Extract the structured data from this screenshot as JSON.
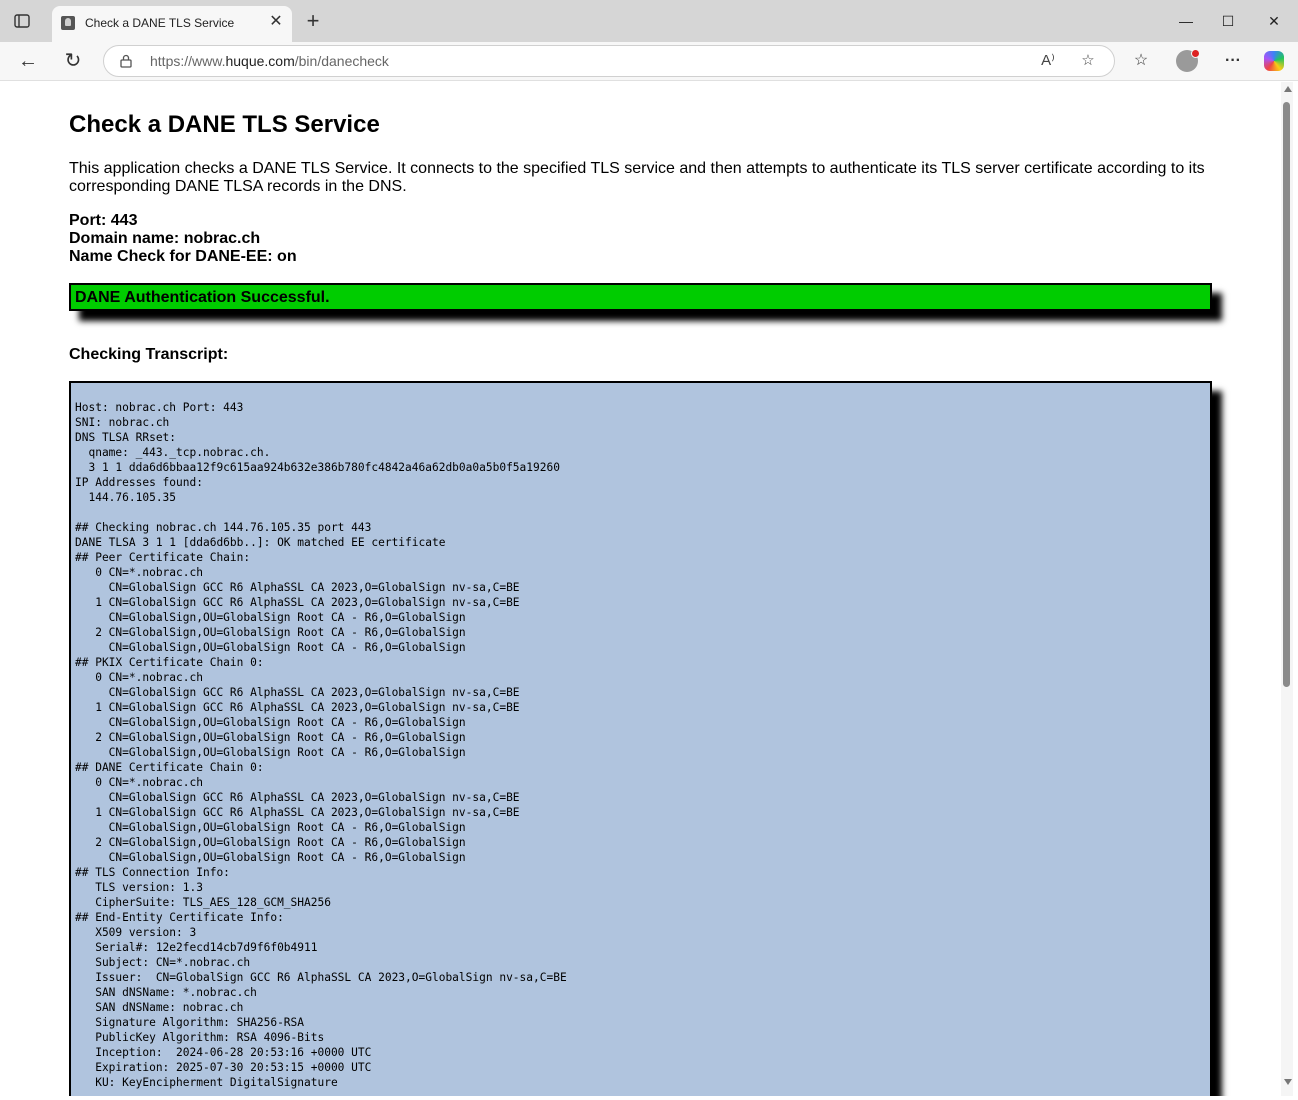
{
  "browser": {
    "tab_title": "Check a DANE TLS Service",
    "url_prefix": "https://www.",
    "url_host": "huque.com",
    "url_path": "/bin/danecheck"
  },
  "page": {
    "heading": "Check a DANE TLS Service",
    "intro": "This application checks a DANE TLS Service. It connects to the specified TLS service and then attempts to authenticate its TLS server certificate according to its corresponding DANE TLSA records in the DNS.",
    "port_line": "Port: 443",
    "domain_line": "Domain name: nobrac.ch",
    "namecheck_line": "Name Check for DANE-EE: on",
    "status": "DANE Authentication Successful.",
    "status_color": "#00cc00",
    "transcript_title": "Checking Transcript:",
    "transcript_bg": "#b0c4de",
    "transcript": "Host: nobrac.ch Port: 443\nSNI: nobrac.ch\nDNS TLSA RRset:\n  qname: _443._tcp.nobrac.ch.\n  3 1 1 dda6d6bbaa12f9c615aa924b632e386b780fc4842a46a62db0a0a5b0f5a19260\nIP Addresses found:\n  144.76.105.35\n\n## Checking nobrac.ch 144.76.105.35 port 443\nDANE TLSA 3 1 1 [dda6d6bb..]: OK matched EE certificate\n## Peer Certificate Chain:\n   0 CN=*.nobrac.ch\n     CN=GlobalSign GCC R6 AlphaSSL CA 2023,O=GlobalSign nv-sa,C=BE\n   1 CN=GlobalSign GCC R6 AlphaSSL CA 2023,O=GlobalSign nv-sa,C=BE\n     CN=GlobalSign,OU=GlobalSign Root CA - R6,O=GlobalSign\n   2 CN=GlobalSign,OU=GlobalSign Root CA - R6,O=GlobalSign\n     CN=GlobalSign,OU=GlobalSign Root CA - R6,O=GlobalSign\n## PKIX Certificate Chain 0:\n   0 CN=*.nobrac.ch\n     CN=GlobalSign GCC R6 AlphaSSL CA 2023,O=GlobalSign nv-sa,C=BE\n   1 CN=GlobalSign GCC R6 AlphaSSL CA 2023,O=GlobalSign nv-sa,C=BE\n     CN=GlobalSign,OU=GlobalSign Root CA - R6,O=GlobalSign\n   2 CN=GlobalSign,OU=GlobalSign Root CA - R6,O=GlobalSign\n     CN=GlobalSign,OU=GlobalSign Root CA - R6,O=GlobalSign\n## DANE Certificate Chain 0:\n   0 CN=*.nobrac.ch\n     CN=GlobalSign GCC R6 AlphaSSL CA 2023,O=GlobalSign nv-sa,C=BE\n   1 CN=GlobalSign GCC R6 AlphaSSL CA 2023,O=GlobalSign nv-sa,C=BE\n     CN=GlobalSign,OU=GlobalSign Root CA - R6,O=GlobalSign\n   2 CN=GlobalSign,OU=GlobalSign Root CA - R6,O=GlobalSign\n     CN=GlobalSign,OU=GlobalSign Root CA - R6,O=GlobalSign\n## TLS Connection Info:\n   TLS version: 1.3\n   CipherSuite: TLS_AES_128_GCM_SHA256\n## End-Entity Certificate Info:\n   X509 version: 3\n   Serial#: 12e2fecd14cb7d9f6f0b4911\n   Subject: CN=*.nobrac.ch\n   Issuer:  CN=GlobalSign GCC R6 AlphaSSL CA 2023,O=GlobalSign nv-sa,C=BE\n   SAN dNSName: *.nobrac.ch\n   SAN dNSName: nobrac.ch\n   Signature Algorithm: SHA256-RSA\n   PublicKey Algorithm: RSA 4096-Bits\n   Inception:  2024-06-28 20:53:16 +0000 UTC\n   Expiration: 2025-07-30 20:53:15 +0000 UTC\n   KU: KeyEncipherment DigitalSignature"
  },
  "icons": {
    "tab_actions": "tab-actions-icon",
    "favicon": "favicon-icon",
    "close": "close-icon",
    "new_tab": "plus-icon",
    "minimize": "minimize-icon",
    "maximize": "maximize-icon",
    "window_close": "window-close-icon",
    "back": "back-arrow-icon",
    "refresh": "refresh-icon",
    "lock": "lock-icon",
    "read_aloud": "read-aloud-icon",
    "favorite": "star-icon",
    "favorites": "favorites-icon",
    "profile": "profile-icon",
    "more": "more-icon",
    "copilot": "copilot-icon"
  }
}
